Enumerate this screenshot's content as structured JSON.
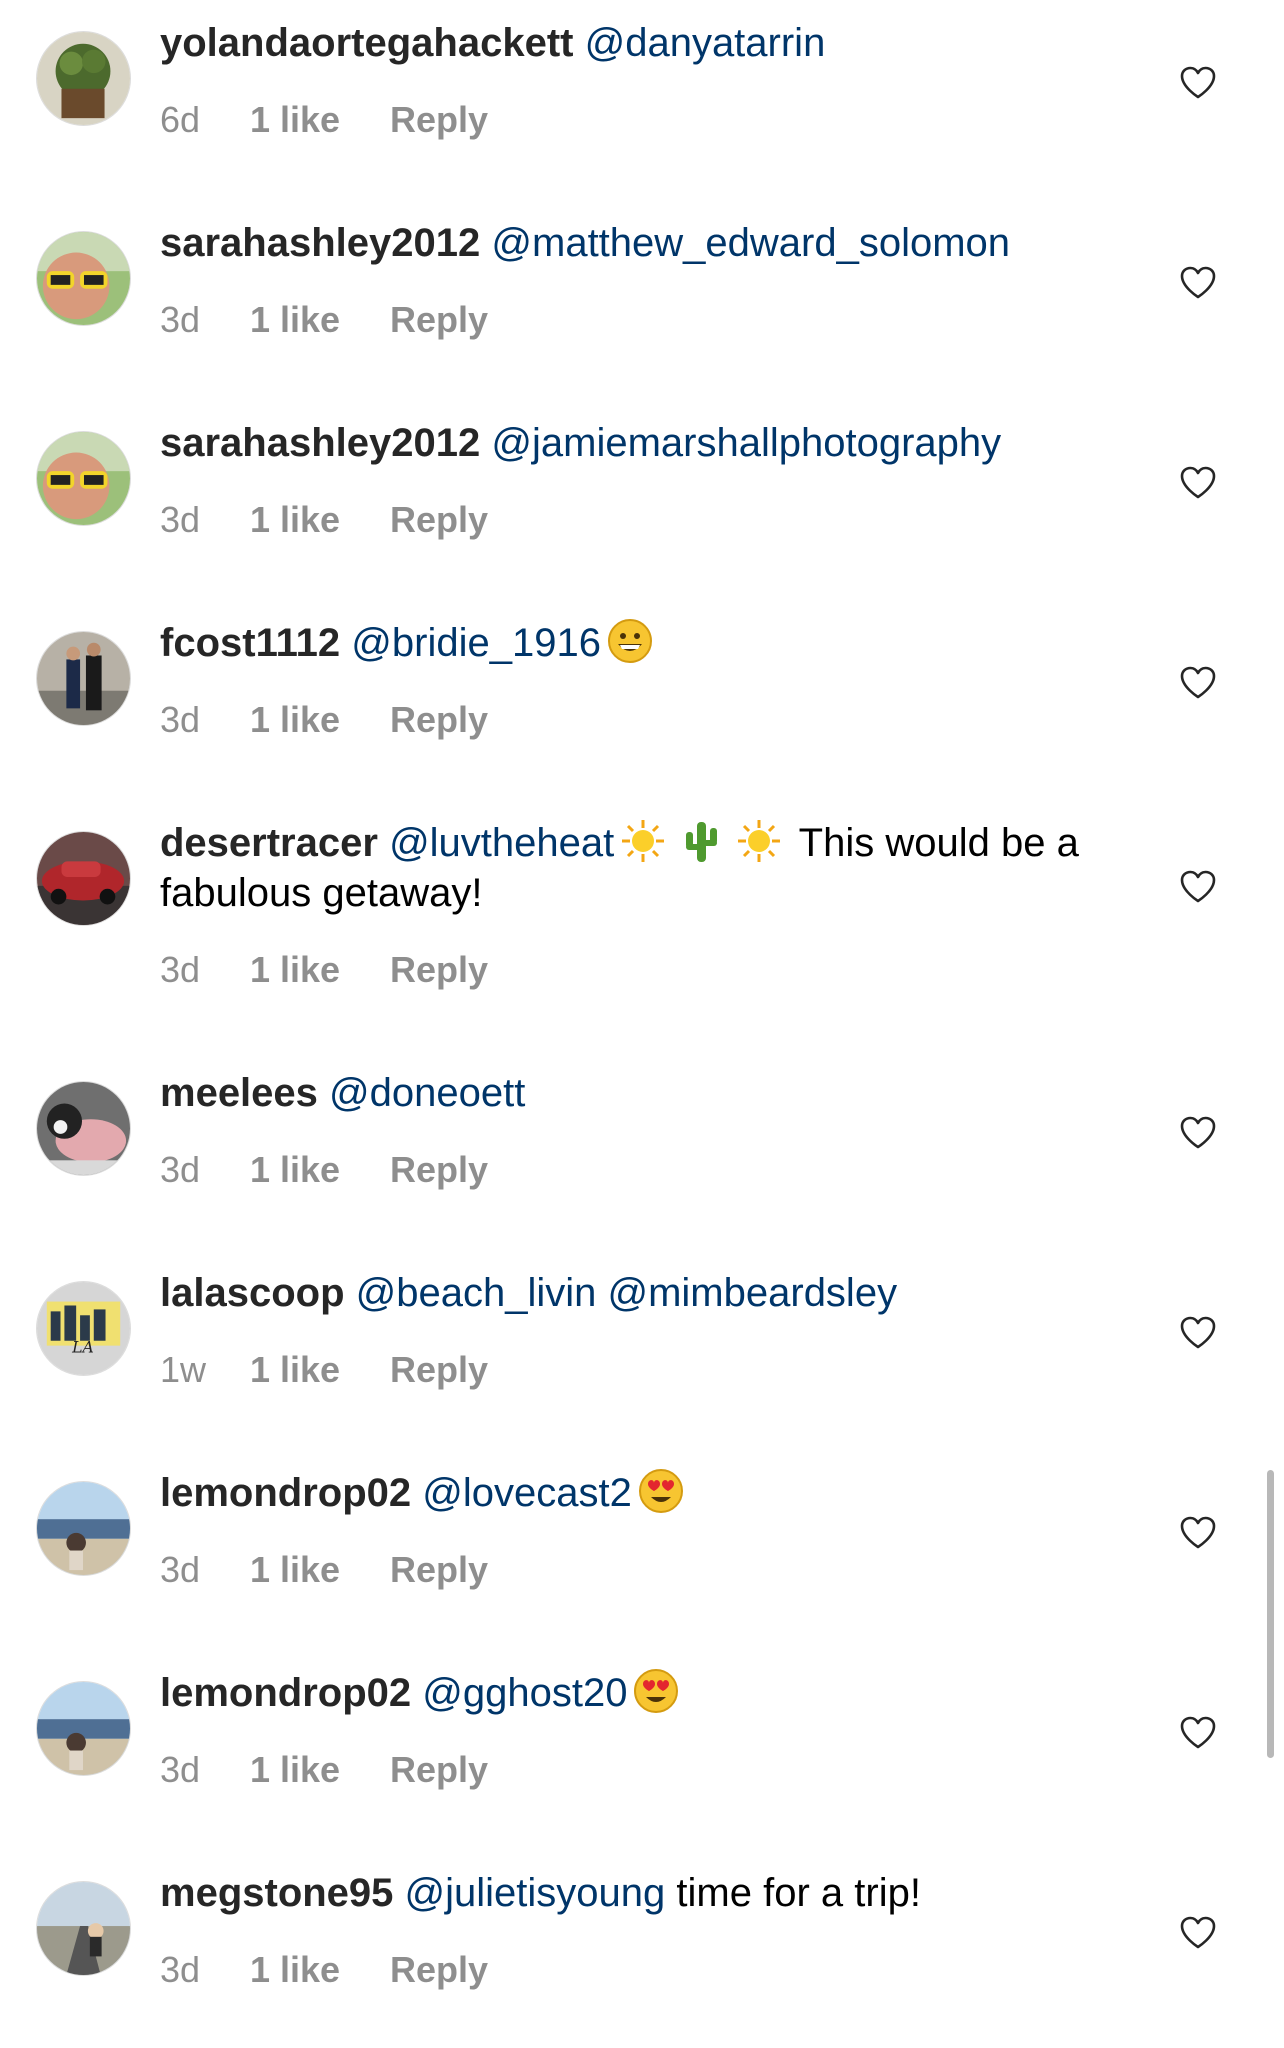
{
  "comments": [
    {
      "user": "yolandaortegahackett",
      "mentions": "@danyatarrin",
      "tail": "",
      "time": "6d",
      "likes": "1 like",
      "reply": "Reply",
      "emoji": [],
      "avatar": "plant"
    },
    {
      "user": "sarahashley2012",
      "mentions": "@matthew_edward_solomon",
      "tail": "",
      "time": "3d",
      "likes": "1 like",
      "reply": "Reply",
      "emoji": [],
      "avatar": "sunglasses"
    },
    {
      "user": "sarahashley2012",
      "mentions": "@jamiemarshallphotography",
      "tail": "",
      "time": "3d",
      "likes": "1 like",
      "reply": "Reply",
      "emoji": [],
      "avatar": "sunglasses"
    },
    {
      "user": "fcost1112",
      "mentions": "@bridie_1916",
      "tail": "",
      "time": "3d",
      "likes": "1 like",
      "reply": "Reply",
      "emoji": [
        "grinning-face-emoji"
      ],
      "avatar": "couple"
    },
    {
      "user": "desertracer",
      "mentions": "@luvtheheat",
      "tail": "This would be a fabulous getaway!",
      "time": "3d",
      "likes": "1 like",
      "reply": "Reply",
      "emoji": [
        "sun-emoji",
        "cactus-emoji",
        "sun-emoji"
      ],
      "avatar": "redcar"
    },
    {
      "user": "meelees",
      "mentions": "@doneoett",
      "tail": "",
      "time": "3d",
      "likes": "1 like",
      "reply": "Reply",
      "emoji": [],
      "avatar": "dog"
    },
    {
      "user": "lalascoop",
      "mentions": "@beach_livin @mimbeardsley",
      "tail": "",
      "time": "1w",
      "likes": "1 like",
      "reply": "Reply",
      "emoji": [],
      "avatar": "losangeles"
    },
    {
      "user": "lemondrop02",
      "mentions": "@lovecast2",
      "tail": "",
      "time": "3d",
      "likes": "1 like",
      "reply": "Reply",
      "emoji": [
        "heart-eyes-emoji"
      ],
      "avatar": "beach"
    },
    {
      "user": "lemondrop02",
      "mentions": "@gghost20",
      "tail": "",
      "time": "3d",
      "likes": "1 like",
      "reply": "Reply",
      "emoji": [
        "heart-eyes-emoji"
      ],
      "avatar": "beach"
    },
    {
      "user": "megstone95",
      "mentions": "@julietisyoung",
      "tail": "time for a trip!",
      "time": "3d",
      "likes": "1 like",
      "reply": "Reply",
      "emoji": [],
      "avatar": "road"
    }
  ],
  "colors": {
    "username": "#262626",
    "mention": "#003569",
    "meta": "#8e8e8e",
    "background": "#ffffff"
  },
  "icons": {
    "like": "heart-outline-icon"
  }
}
